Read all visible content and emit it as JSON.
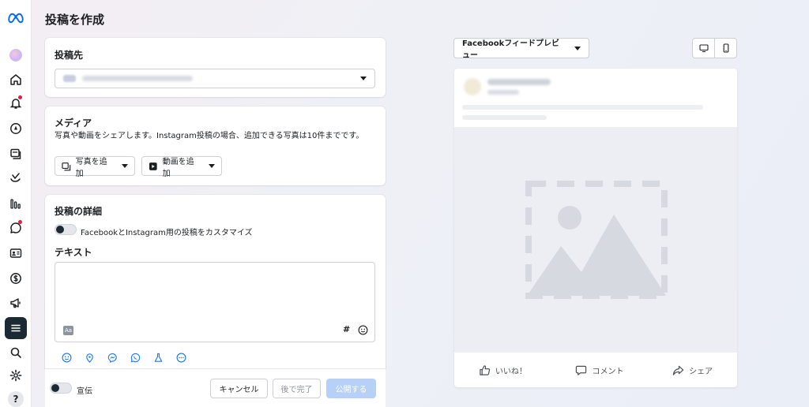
{
  "page": {
    "title": "投稿を作成"
  },
  "sidebar": {
    "items": [
      {
        "icon": "meta-logo-icon"
      },
      {
        "icon": "account-avatar"
      },
      {
        "icon": "home-icon"
      },
      {
        "icon": "bell-icon",
        "badge": true
      },
      {
        "icon": "compass-icon"
      },
      {
        "icon": "content-icon"
      },
      {
        "icon": "activity-icon"
      },
      {
        "icon": "insights-icon"
      },
      {
        "icon": "inbox-icon",
        "badge": true
      },
      {
        "icon": "contacts-icon"
      },
      {
        "icon": "dollar-icon"
      },
      {
        "icon": "megaphone-icon"
      },
      {
        "icon": "menu-icon",
        "active": true
      },
      {
        "icon": "search-icon"
      },
      {
        "icon": "gear-icon"
      }
    ],
    "help": "?"
  },
  "destination": {
    "title": "投稿先"
  },
  "media": {
    "title": "メディア",
    "description": "写真や動画をシェアします。Instagram投稿の場合、追加できる写真は10件までです。",
    "add_photo": "写真を追加",
    "add_video": "動画を追加"
  },
  "details": {
    "title": "投稿の詳細",
    "customize_label": "FacebookとInstagram用の投稿をカスタマイズ",
    "text_label": "テキスト",
    "text_value": "",
    "aa_icon": "Aa",
    "hashtag": "#"
  },
  "footer": {
    "boost_label": "宣伝",
    "cancel": "キャンセル",
    "finish_later": "後で完了",
    "publish": "公開する"
  },
  "preview": {
    "dropdown_label": "Facebookフィードプレビュー",
    "like": "いいね！",
    "comment": "コメント",
    "share": "シェア"
  },
  "colors": {
    "accent": "#1877f2",
    "dark": "#1c2b33",
    "publish_disabled": "#b7d0f7",
    "badge": "#e41e3f"
  }
}
